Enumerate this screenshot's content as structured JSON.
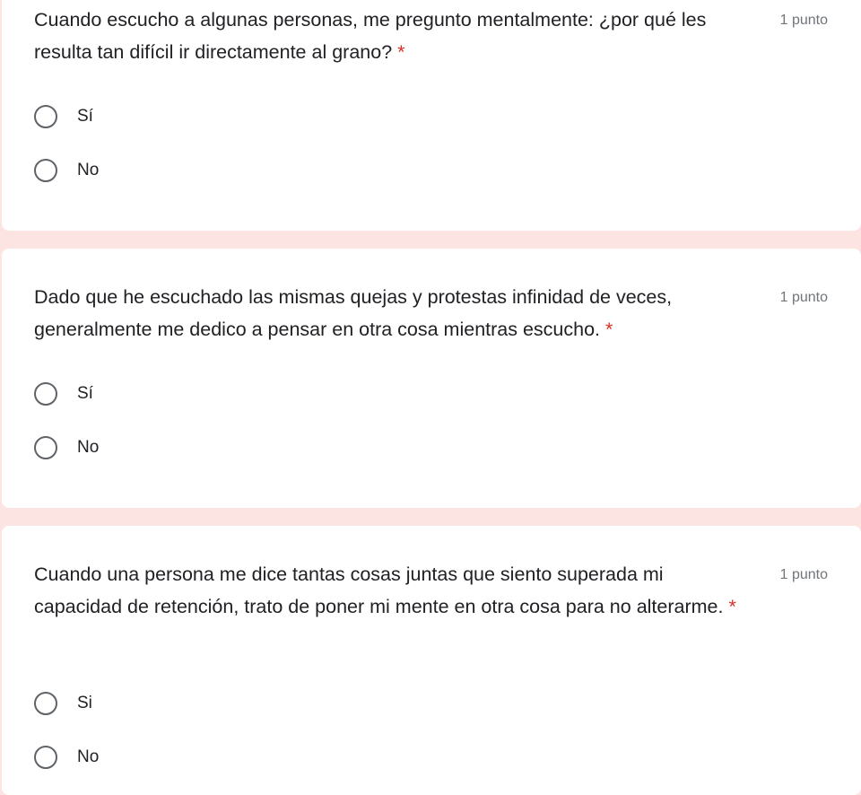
{
  "questions": [
    {
      "text": "Cuando escucho a algunas personas, me pregunto mentalmente: ¿por qué les resulta tan difícil ir directamente al grano?",
      "required_mark": "*",
      "points": "1 punto",
      "options": [
        "Sí",
        "No"
      ]
    },
    {
      "text": "Dado que he escuchado las mismas quejas y protestas infinidad de veces, generalmente me dedico a pensar en otra cosa mientras escucho.",
      "required_mark": "*",
      "points": "1 punto",
      "options": [
        "Sí",
        "No"
      ]
    },
    {
      "text": "Cuando una persona me dice tantas cosas juntas que siento superada mi capacidad de retención, trato de poner mi mente en otra cosa para no alterarme.",
      "required_mark": "*",
      "points": "1 punto",
      "options": [
        "Si",
        "No"
      ]
    }
  ],
  "colors": {
    "page_background": "#fce4e3",
    "card_background": "#ffffff",
    "required": "#d93025",
    "points_text": "#70757a",
    "radio_border": "#5f6368"
  },
  "icons": {
    "radio": "radio-unchecked-icon"
  }
}
